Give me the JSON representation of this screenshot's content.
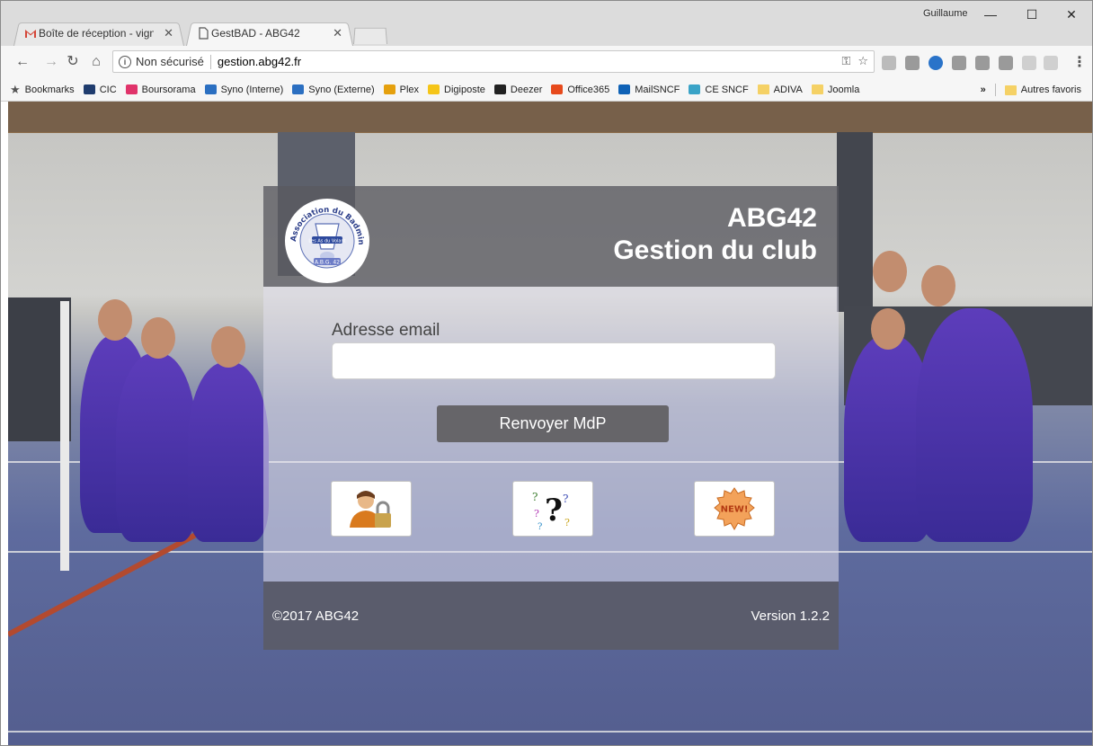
{
  "browser": {
    "profile_name": "Guillaume",
    "tabs": [
      {
        "title": "Boîte de réception - vign",
        "icon": "gmail-icon",
        "active": false
      },
      {
        "title": "GestBAD - ABG42",
        "icon": "page-icon",
        "active": true
      }
    ],
    "window_controls": {
      "minimize": "—",
      "maximize": "☐",
      "close": "✕"
    },
    "address": {
      "security_label": "Non sécurisé",
      "url": "gestion.abg42.fr"
    },
    "bookmarks": [
      {
        "label": "Bookmarks",
        "icon": "star-icon",
        "color": "#555555"
      },
      {
        "label": "CIC",
        "icon": "cic-icon",
        "color": "#1f3c6e"
      },
      {
        "label": "Boursorama",
        "icon": "boursorama-icon",
        "color": "#e0336a"
      },
      {
        "label": "Syno (Interne)",
        "icon": "dsm-icon",
        "color": "#2b6fc1"
      },
      {
        "label": "Syno (Externe)",
        "icon": "dsm-icon",
        "color": "#2b6fc1"
      },
      {
        "label": "Plex",
        "icon": "plex-icon",
        "color": "#e5a00d"
      },
      {
        "label": "Digiposte",
        "icon": "digiposte-icon",
        "color": "#f5c518"
      },
      {
        "label": "Deezer",
        "icon": "deezer-icon",
        "color": "#222222"
      },
      {
        "label": "Office365",
        "icon": "office-icon",
        "color": "#e74a1c"
      },
      {
        "label": "MailSNCF",
        "icon": "outlook-icon",
        "color": "#0f62b6"
      },
      {
        "label": "CE SNCF",
        "icon": "ce-sncf-icon",
        "color": "#3aa3c7"
      },
      {
        "label": "ADIVA",
        "icon": "folder-icon",
        "color": "#f5d165"
      },
      {
        "label": "Joomla",
        "icon": "folder-icon",
        "color": "#f5d165"
      }
    ],
    "bookmarks_overflow": "»",
    "other_bookmarks": "Autres favoris"
  },
  "login": {
    "logo_text": "Association du Badminton de Genilac",
    "logo_banner": "Les As du Volant",
    "logo_label": "A.B.G. 42",
    "title_line1": "ABG42",
    "title_line2": "Gestion du club",
    "email_label": "Adresse email",
    "email_value": "",
    "resend_button": "Renvoyer MdP",
    "icon_buttons": [
      {
        "name": "login-user-lock-icon"
      },
      {
        "name": "help-question-icon"
      },
      {
        "name": "new-badge-icon"
      }
    ],
    "badge_text": "NEW!",
    "copyright": "©2017 ABG42",
    "version": "Version 1.2.2",
    "colors": {
      "header": "#5a5a60",
      "button": "#666569",
      "footer": "#5a5a64"
    }
  }
}
